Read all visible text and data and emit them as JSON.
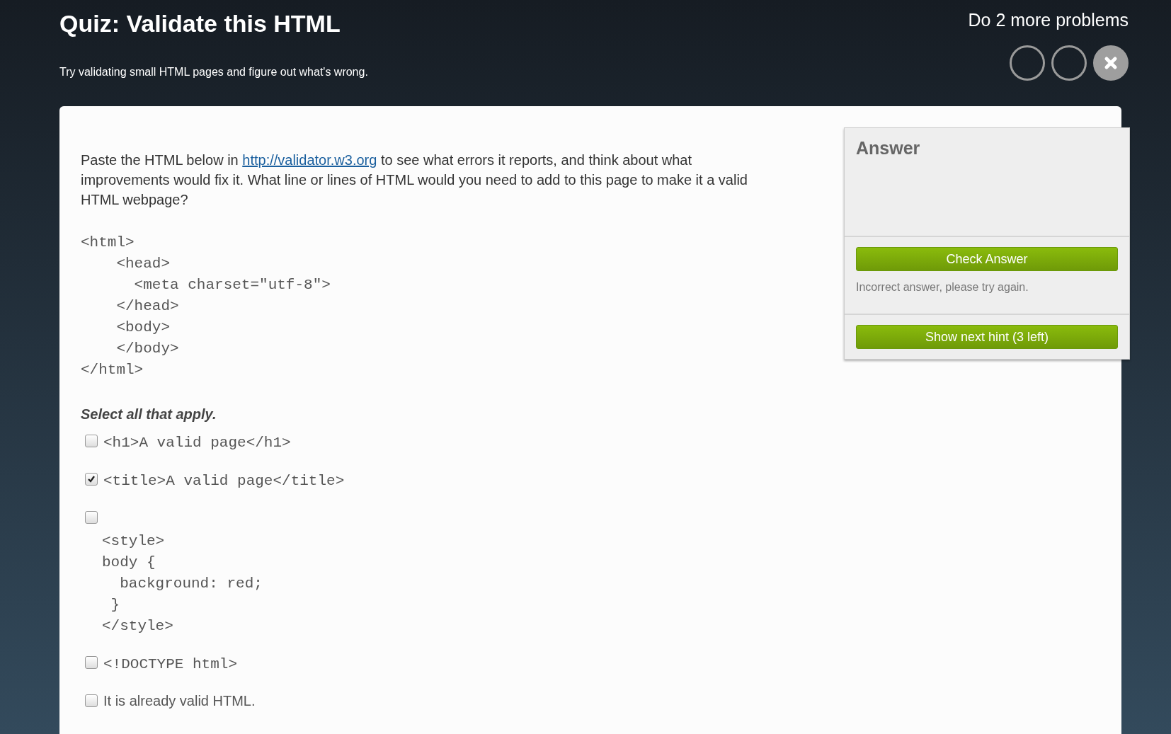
{
  "header": {
    "title": "Quiz: Validate this HTML",
    "subtitle": "Try validating small HTML pages and figure out what's wrong.",
    "remaining": "Do 2 more problems",
    "progress": [
      {
        "wrong": false
      },
      {
        "wrong": false
      },
      {
        "wrong": true
      }
    ]
  },
  "question": {
    "before_link": "Paste the HTML below in ",
    "link": "http://validator.w3.org",
    "after_link": " to see what errors it reports, and think about what improvements would fix it. What line or lines of HTML would you need to add to this page to make it a valid HTML webpage?",
    "code": [
      "<html>",
      "    <head>",
      "      <meta charset=\"utf-8\">",
      "    </head>",
      "    <body>",
      "    </body>",
      "</html>"
    ],
    "instruction": "Select all that apply.",
    "options": [
      {
        "kind": "code",
        "lines": [
          "<h1>A valid page</h1>"
        ],
        "checked": false
      },
      {
        "kind": "code",
        "lines": [
          "<title>A valid page</title>"
        ],
        "checked": true
      },
      {
        "kind": "code-block",
        "lines": [
          "<style>",
          "body {",
          "  background: red;",
          " }",
          "</style>"
        ],
        "checked": false
      },
      {
        "kind": "code",
        "lines": [
          "<!DOCTYPE html>"
        ],
        "checked": false
      },
      {
        "kind": "text",
        "lines": [
          "It is already valid HTML."
        ],
        "checked": false
      }
    ]
  },
  "answer_panel": {
    "title": "Answer",
    "check_button": "Check Answer",
    "feedback": "Incorrect answer, please try again.",
    "hint_button": "Show next hint (3 left)"
  }
}
